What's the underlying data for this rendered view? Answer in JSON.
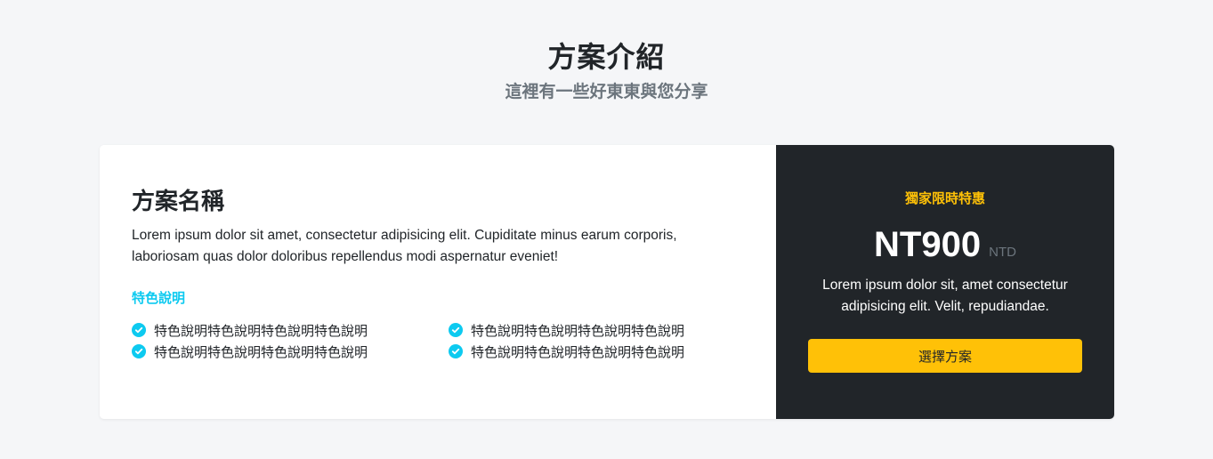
{
  "header": {
    "title": "方案介紹",
    "subtitle": "這裡有一些好東東與您分享"
  },
  "plan": {
    "name": "方案名稱",
    "description": "Lorem ipsum dolor sit amet, consectetur adipisicing elit. Cupiditate minus earum corporis, laboriosam quas dolor doloribus repellendus modi aspernatur eveniet!",
    "features_title": "特色說明",
    "features": [
      "特色說明特色說明特色說明特色說明",
      "特色說明特色說明特色說明特色說明",
      "特色說明特色說明特色說明特色說明",
      "特色說明特色說明特色說明特色說明"
    ],
    "feature_icon": "check-circle-icon"
  },
  "pricing": {
    "promo": "獨家限時特惠",
    "price": "NT900",
    "currency": "NTD",
    "description": "Lorem ipsum dolor sit, amet consectetur adipisicing elit. Velit, repudiandae.",
    "button_label": "選擇方案"
  },
  "colors": {
    "accent_cyan": "#0dcaf0",
    "accent_yellow": "#ffc107",
    "dark_panel": "#212529",
    "page_background": "#f5f6f8"
  }
}
